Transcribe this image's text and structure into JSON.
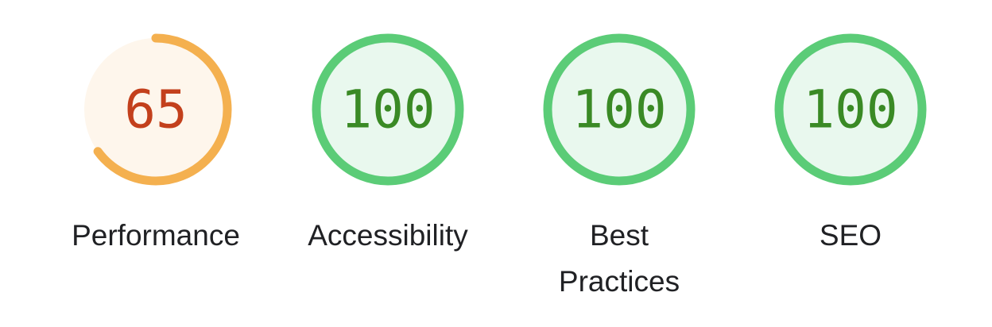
{
  "gauges": [
    {
      "id": "performance",
      "score": 65,
      "score_text": "65",
      "label": "Performance",
      "status": "average"
    },
    {
      "id": "accessibility",
      "score": 100,
      "score_text": "100",
      "label": "Accessibility",
      "status": "pass"
    },
    {
      "id": "best-practices",
      "score": 100,
      "score_text": "100",
      "label": "Best\nPractices",
      "status": "pass"
    },
    {
      "id": "seo",
      "score": 100,
      "score_text": "100",
      "label": "SEO",
      "status": "pass"
    }
  ],
  "colors": {
    "average": {
      "arc": "#f4b04f",
      "fill": "#fef6ec",
      "text": "#c3401c"
    },
    "pass": {
      "arc": "#5bcc77",
      "fill": "#e9f8ee",
      "text": "#3a8a25"
    },
    "label": "#202124"
  }
}
